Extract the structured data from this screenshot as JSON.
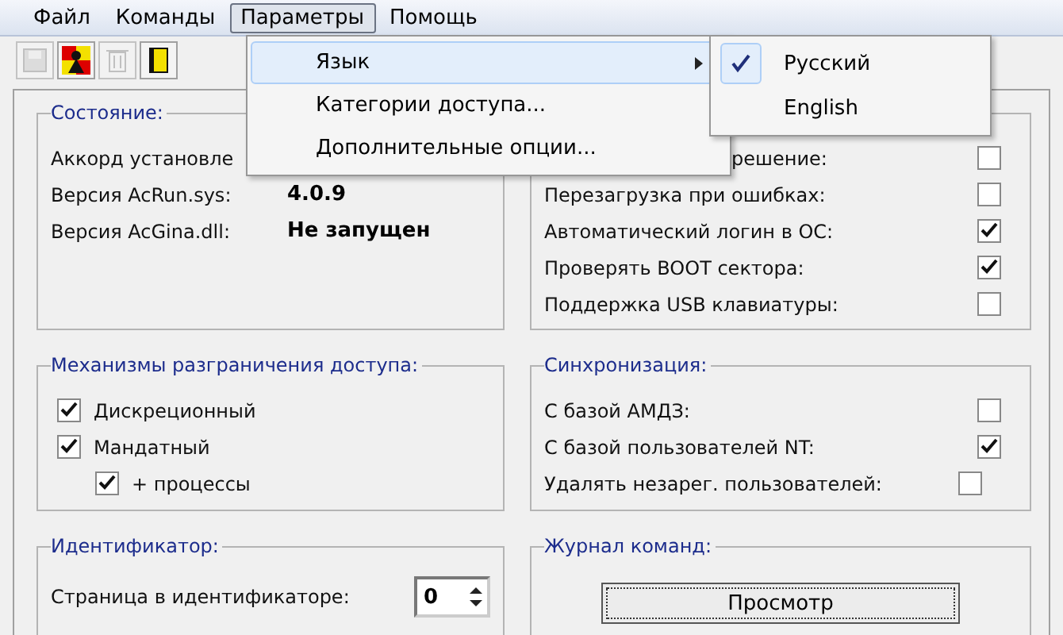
{
  "menu_bar": [
    {
      "label": "Файл",
      "selected": false
    },
    {
      "label": "Команды",
      "selected": false
    },
    {
      "label": "Параметры",
      "selected": true
    },
    {
      "label": "Помощь",
      "selected": false
    }
  ],
  "toolbar": [
    {
      "kind": "save",
      "disabled": true
    },
    {
      "kind": "user",
      "disabled": false
    },
    {
      "kind": "trash",
      "disabled": true
    },
    {
      "kind": "exit",
      "disabled": false
    }
  ],
  "status_group": {
    "title": "Состояние:",
    "rows": [
      {
        "label": "Аккорд установле"
      },
      {
        "label": "Версия AcRun.sys:",
        "value": "4.0.9"
      },
      {
        "label": "Версия AcGina.dll:",
        "value": "Не запущен"
      }
    ]
  },
  "options_group": {
    "rows": [
      {
        "label": "решение:",
        "checked": false,
        "partial": true
      },
      {
        "label": "Перезагрузка при ошибках:",
        "checked": false
      },
      {
        "label": "Автоматический логин в ОС:",
        "checked": true
      },
      {
        "label": "Проверять BOOT сектора:",
        "checked": true
      },
      {
        "label": "Поддержка USB клавиатуры:",
        "checked": false
      }
    ]
  },
  "access_group": {
    "title": "Механизмы разграничения доступа:",
    "items": [
      {
        "label": "Дискреционный",
        "checked": true
      },
      {
        "label": "Мандатный",
        "checked": true,
        "children": [
          {
            "label": "+ процессы",
            "checked": true
          }
        ]
      }
    ]
  },
  "sync_group": {
    "title": "Синхронизация:",
    "rows": [
      {
        "label": "С базой АМДЗ:",
        "checked": false
      },
      {
        "label": "С базой пользователей NT:",
        "checked": true
      },
      {
        "label": "Удалять незарег. пользователей:",
        "checked": false
      }
    ]
  },
  "id_group": {
    "title": "Идентификатор:",
    "label": "Страница в идентификаторе:",
    "value": "0"
  },
  "log_group": {
    "title": "Журнал команд:",
    "button": "Просмотр"
  },
  "dropdown": {
    "items": [
      {
        "label": "Язык",
        "selected": true,
        "submenu": true
      },
      {
        "label": "Категории доступа...",
        "selected": false,
        "submenu": false
      },
      {
        "label": "Дополнительные опции...",
        "selected": false,
        "submenu": false
      }
    ]
  },
  "submenu": {
    "items": [
      {
        "label": "Русский",
        "selected": true
      },
      {
        "label": "English",
        "selected": false
      }
    ]
  }
}
